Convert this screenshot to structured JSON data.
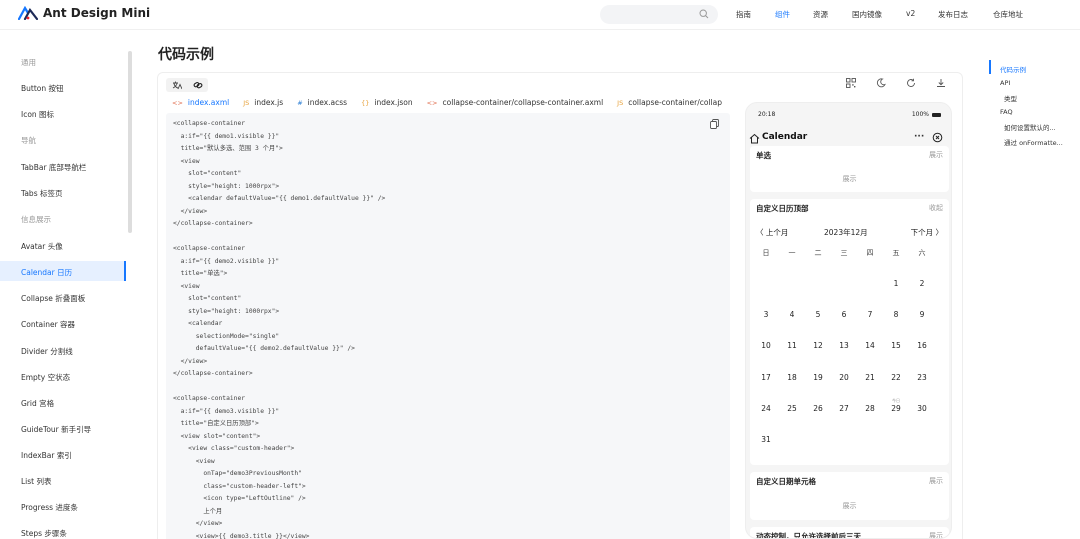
{
  "header": {
    "title": "Ant Design Mini",
    "nav": [
      "指南",
      "组件",
      "资源",
      "国内镜像",
      "v2",
      "发布日志",
      "仓库地址"
    ],
    "active_nav": "组件"
  },
  "sidebar": {
    "items": [
      {
        "label": "通用",
        "group": true
      },
      {
        "label": "Button 按钮"
      },
      {
        "label": "Icon 图标"
      },
      {
        "label": "导航",
        "group": true
      },
      {
        "label": "TabBar 底部导航栏"
      },
      {
        "label": "Tabs 标签页"
      },
      {
        "label": "信息展示",
        "group": true
      },
      {
        "label": "Avatar 头像"
      },
      {
        "label": "Calendar 日历",
        "active": true
      },
      {
        "label": "Collapse 折叠面板"
      },
      {
        "label": "Container 容器"
      },
      {
        "label": "Divider 分割线"
      },
      {
        "label": "Empty 空状态"
      },
      {
        "label": "Grid 宫格"
      },
      {
        "label": "GuideTour 新手引导"
      },
      {
        "label": "IndexBar 索引"
      },
      {
        "label": "List 列表"
      },
      {
        "label": "Progress 进度条"
      },
      {
        "label": "Steps 步骤条"
      }
    ]
  },
  "main": {
    "title": "代码示例",
    "tabs": [
      {
        "ext": "<>",
        "label": "index.axml"
      },
      {
        "ext": "JS",
        "label": "index.js"
      },
      {
        "ext": "#",
        "label": "index.acss"
      },
      {
        "ext": "{}",
        "label": "index.json"
      },
      {
        "ext": "<>",
        "label": "collapse-container/collapse-container.axml"
      },
      {
        "ext": "JS",
        "label": "collapse-container/collap"
      }
    ],
    "code_lines": [
      "<collapse-container",
      "  a:if=\"{{ demo1.visible }}\"",
      "  title=\"默认多选、范围 3 个月\">",
      "  <view",
      "    slot=\"content\"",
      "    style=\"height: 1000rpx\">",
      "    <calendar defaultValue=\"{{ demo1.defaultValue }}\" />",
      "  </view>",
      "</collapse-container>",
      "",
      "<collapse-container",
      "  a:if=\"{{ demo2.visible }}\"",
      "  title=\"单选\">",
      "  <view",
      "    slot=\"content\"",
      "    style=\"height: 1000rpx\">",
      "    <calendar",
      "      selectionMode=\"single\"",
      "      defaultValue=\"{{ demo2.defaultValue }}\" />",
      "  </view>",
      "</collapse-container>",
      "",
      "<collapse-container",
      "  a:if=\"{{ demo3.visible }}\"",
      "  title=\"自定义日历顶部\">",
      "  <view slot=\"content\">",
      "    <view class=\"custom-header\">",
      "      <view",
      "        onTap=\"demo3PreviousMonth\"",
      "        class=\"custom-header-left\">",
      "        <icon type=\"LeftOutline\" />",
      "        上个月",
      "      </view>",
      "      <view>{{ demo3.title }}</view>"
    ]
  },
  "toc": [
    "代码示例",
    "API",
    "类型",
    "FAQ",
    "如何设置默认的...",
    "通过 onFormatte..."
  ],
  "phone": {
    "time": "20:18",
    "battery": "100%",
    "nav_title": "Calendar",
    "more": "···",
    "cards": [
      {
        "title": "单选",
        "action": "展示",
        "body": "展示"
      },
      {
        "title": "自定义日历顶部",
        "action": "收起"
      },
      {
        "title": "自定义日期单元格",
        "action": "展示",
        "body": "展示"
      },
      {
        "title": "动态控制，只允许选择前后三天",
        "action": "展示"
      }
    ],
    "calendar": {
      "prev": "〈 上个月",
      "title": "2023年12月",
      "next": "下个月 〉",
      "weekdays": [
        "日",
        "一",
        "二",
        "三",
        "四",
        "五",
        "六"
      ],
      "weeks": [
        [
          "",
          "",
          "",
          "",
          "",
          "1",
          "2"
        ],
        [
          "3",
          "4",
          "5",
          "6",
          "7",
          "8",
          "9"
        ],
        [
          "10",
          "11",
          "12",
          "13",
          "14",
          "15",
          "16"
        ],
        [
          "17",
          "18",
          "19",
          "20",
          "21",
          "22",
          "23"
        ],
        [
          "24",
          "25",
          "26",
          "27",
          "28",
          "29",
          "30"
        ],
        [
          "31",
          "",
          "",
          "",
          "",
          "",
          ""
        ]
      ],
      "today_label": "今日",
      "today": "29"
    }
  }
}
